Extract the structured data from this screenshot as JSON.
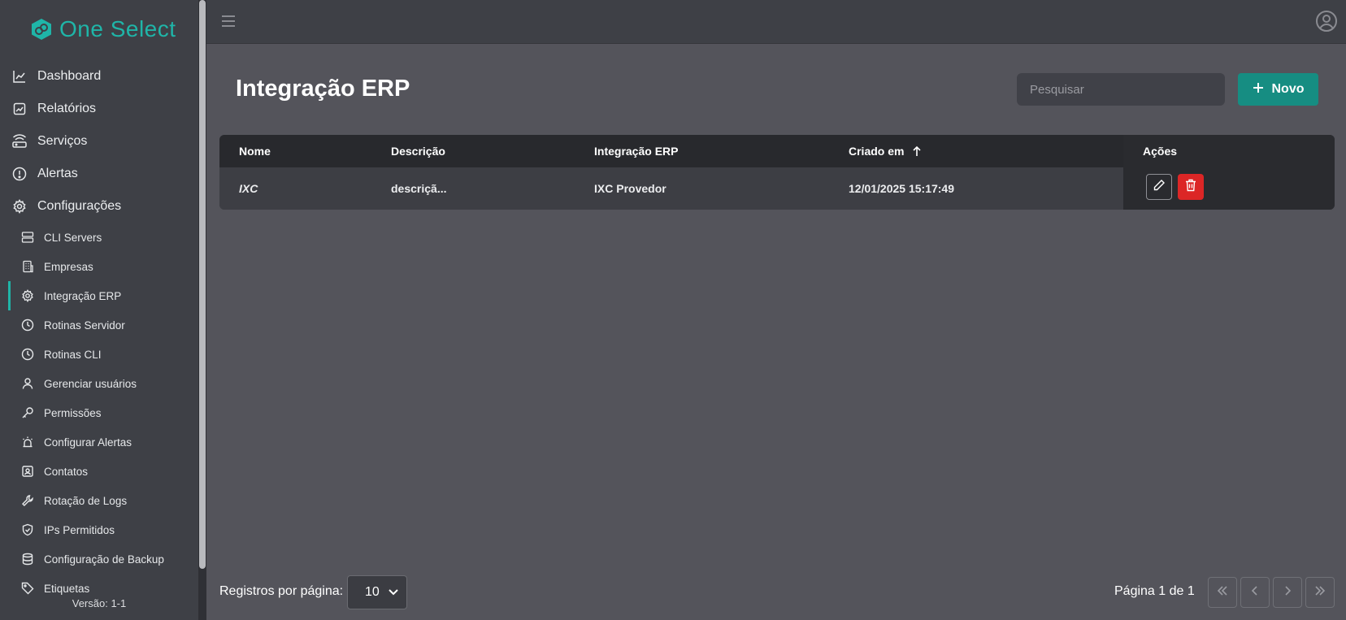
{
  "brand": {
    "name": "One Select",
    "accent": "#1fb5a8"
  },
  "sidebar": {
    "main": [
      {
        "label": "Dashboard",
        "icon": "chart-icon"
      },
      {
        "label": "Relatórios",
        "icon": "report-icon"
      },
      {
        "label": "Serviços",
        "icon": "router-icon"
      },
      {
        "label": "Alertas",
        "icon": "alert-icon"
      },
      {
        "label": "Configurações",
        "icon": "gear-icon"
      }
    ],
    "sub": [
      {
        "label": "CLI Servers",
        "icon": "server-icon"
      },
      {
        "label": "Empresas",
        "icon": "building-icon"
      },
      {
        "label": "Integração ERP",
        "icon": "gear-icon",
        "active": true
      },
      {
        "label": "Rotinas Servidor",
        "icon": "clock-icon"
      },
      {
        "label": "Rotinas CLI",
        "icon": "clock-icon"
      },
      {
        "label": "Gerenciar usuários",
        "icon": "user-icon"
      },
      {
        "label": "Permissões",
        "icon": "key-icon"
      },
      {
        "label": "Configurar Alertas",
        "icon": "siren-icon"
      },
      {
        "label": "Contatos",
        "icon": "contact-icon"
      },
      {
        "label": "Rotação de Logs",
        "icon": "wrench-icon"
      },
      {
        "label": "IPs Permitidos",
        "icon": "shield-icon"
      },
      {
        "label": "Configuração de Backup",
        "icon": "database-icon"
      },
      {
        "label": "Etiquetas",
        "icon": "tag-icon"
      }
    ],
    "version": "Versão: 1-1"
  },
  "page": {
    "title": "Integração ERP",
    "search_placeholder": "Pesquisar",
    "new_button": "Novo"
  },
  "table": {
    "headers": {
      "nome": "Nome",
      "descricao": "Descrição",
      "integracao": "Integração ERP",
      "criado": "Criado em",
      "acoes": "Ações"
    },
    "rows": [
      {
        "nome": "IXC",
        "descricao": "descriçã...",
        "integracao": "IXC Provedor",
        "criado": "12/01/2025 15:17:49"
      }
    ]
  },
  "footer": {
    "per_page_label": "Registros por página:",
    "per_page_value": "10",
    "page_info": "Página 1 de 1"
  },
  "colors": {
    "delete": "#dc2626",
    "primary": "#168d82"
  }
}
